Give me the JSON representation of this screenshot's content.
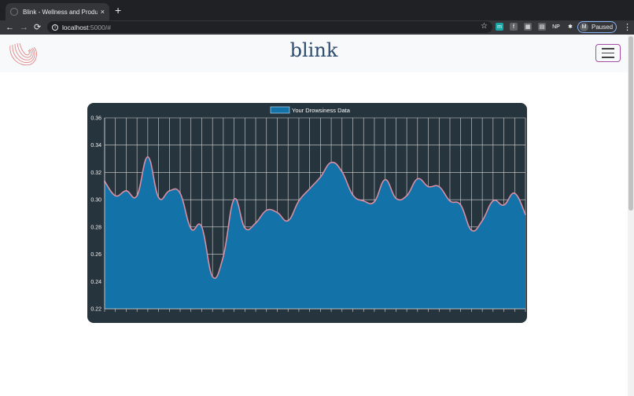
{
  "browser": {
    "tab_title": "Blink - Wellness and Productiv",
    "tab_close": "×",
    "new_tab": "+",
    "url_host": "localhost",
    "url_path": ":5000/#",
    "profile_initial": "M",
    "profile_status": "Paused",
    "extensions": [
      {
        "name": "m-extension-icon",
        "label": "m",
        "color": "#1aa6a6"
      },
      {
        "name": "facebook-extension-icon",
        "label": "f",
        "color": "#5f6368"
      },
      {
        "name": "grid-extension-icon",
        "label": "▦",
        "color": "#5f6368"
      },
      {
        "name": "box-extension-icon",
        "label": "▤",
        "color": "#5f6368"
      },
      {
        "name": "np-extension-icon",
        "label": "NP",
        "color": "#35363a"
      },
      {
        "name": "puzzle-extension-icon",
        "label": "✱",
        "color": "#35363a"
      }
    ]
  },
  "page": {
    "brand": "blink"
  },
  "chart_data": {
    "type": "area",
    "legend": "Your Drowsiness Data",
    "legend_position": "top",
    "colors": {
      "fill": "#1373a8",
      "line": "#d88ea3",
      "grid": "#d6d6d6",
      "tick": "#f0f0f0"
    },
    "ylim": [
      0.22,
      0.36
    ],
    "yticks": [
      "0.36",
      "0.34",
      "0.32",
      "0.30",
      "0.28",
      "0.26",
      "0.24",
      "0.22"
    ],
    "grid": true,
    "values": [
      0.3135,
      0.3029,
      0.3065,
      0.3029,
      0.3314,
      0.3016,
      0.3065,
      0.3047,
      0.2788,
      0.2801,
      0.2436,
      0.2584,
      0.3003,
      0.2792,
      0.2829,
      0.2922,
      0.2906,
      0.2846,
      0.2991,
      0.308,
      0.3166,
      0.3273,
      0.3205,
      0.3035,
      0.2991,
      0.2985,
      0.3147,
      0.301,
      0.3029,
      0.3153,
      0.3096,
      0.3096,
      0.2991,
      0.2961,
      0.2776,
      0.2846,
      0.2991,
      0.2961,
      0.3047,
      0.2892
    ]
  }
}
